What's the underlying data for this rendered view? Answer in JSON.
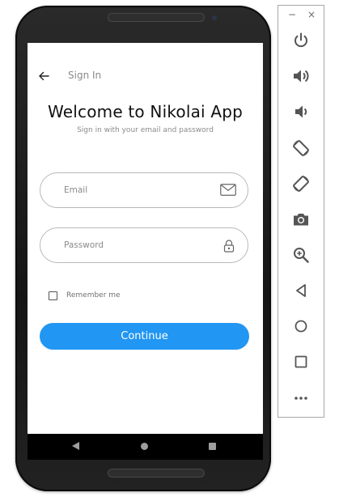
{
  "app": {
    "topbar_title": "Sign In",
    "welcome_title": "Welcome to Nikolai App",
    "subtitle": "Sign in with your email and password"
  },
  "form": {
    "email_placeholder": "Email",
    "password_placeholder": "Password",
    "remember_label": "Remember me",
    "remember_checked": false,
    "continue_label": "Continue"
  },
  "emulator_toolbar": {
    "minimize_label": "−",
    "close_label": "×",
    "buttons": [
      "power-icon",
      "volume-up-icon",
      "volume-down-icon",
      "rotate-left-icon",
      "rotate-right-icon",
      "camera-icon",
      "zoom-icon",
      "back-icon",
      "home-icon",
      "overview-icon",
      "more-icon"
    ]
  },
  "colors": {
    "accent": "#2196f3",
    "toolbar_icon": "#555555",
    "nav_icon": "#9e9e9e"
  }
}
